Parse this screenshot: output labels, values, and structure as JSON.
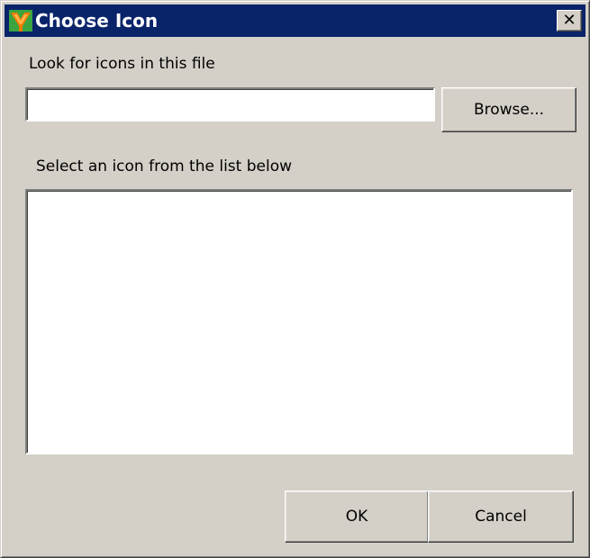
{
  "window": {
    "title": "Choose Icon",
    "close_glyph": "✕"
  },
  "file_section": {
    "label": "Look for icons in this file",
    "input_value": "",
    "browse_label": "Browse..."
  },
  "list_section": {
    "label": "Select an icon from the list below"
  },
  "buttons": {
    "ok_label": "OK",
    "cancel_label": "Cancel"
  },
  "icons": {
    "title_icon": "app-logo-icon",
    "close_icon": "close-icon"
  },
  "colors": {
    "titlebar": "#0a246a",
    "face": "#d4d0c8",
    "logo_orange": "#f47a00",
    "logo_green": "#3aa540"
  }
}
